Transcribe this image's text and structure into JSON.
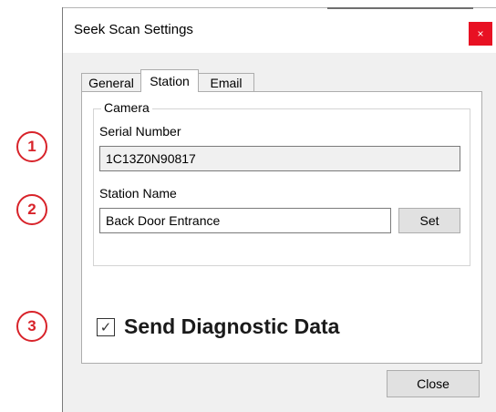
{
  "callouts": [
    "1",
    "2",
    "3"
  ],
  "window": {
    "title": "Seek Scan Settings",
    "close_glyph": "×"
  },
  "tabs": [
    {
      "label": "General",
      "active": false
    },
    {
      "label": "Station",
      "active": true
    },
    {
      "label": "Email",
      "active": false
    }
  ],
  "camera_group": {
    "label": "Camera",
    "serial_label": "Serial Number",
    "serial_value": "1C13Z0N90817",
    "station_label": "Station Name",
    "station_value": "Back Door Entrance",
    "set_button": "Set"
  },
  "diagnostics": {
    "checkbox_glyph": "✓",
    "label": "Send Diagnostic Data",
    "checked": true
  },
  "footer": {
    "close_button": "Close"
  },
  "colors": {
    "callout": "#d8232a",
    "close_x_bg": "#e81123",
    "dialog_bg": "#f0f0f0"
  }
}
